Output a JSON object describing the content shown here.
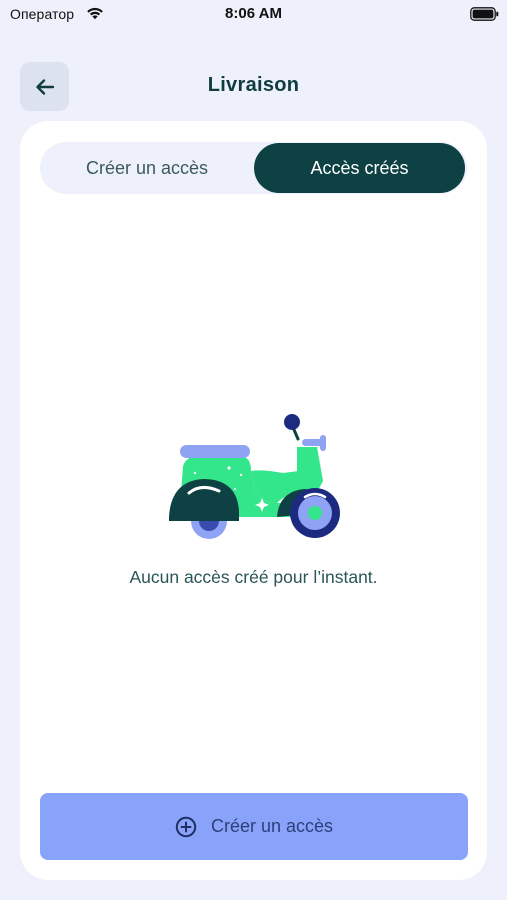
{
  "status_bar": {
    "carrier": "Оператор",
    "time": "8:06 AM",
    "wifi_icon": "wifi-icon",
    "battery_icon": "battery-full-icon"
  },
  "header": {
    "back_icon": "arrow-left-icon",
    "title": "Livraison"
  },
  "tabs": [
    {
      "label": "Créer un accès",
      "selected": false
    },
    {
      "label": "Accès créés",
      "selected": true
    }
  ],
  "empty_state": {
    "illustration": "scooter-illustration",
    "message": "Aucun accès créé pour l’instant."
  },
  "primary_button": {
    "icon": "plus-circle-icon",
    "label": "Créer un accès",
    "enabled": false
  },
  "colors": {
    "background": "#eef0fb",
    "accent_dark": "#0d4143",
    "button_disabled": "#8aa3fa",
    "scooter_green": "#33e58b",
    "scooter_blue": "#8fa3f5"
  }
}
